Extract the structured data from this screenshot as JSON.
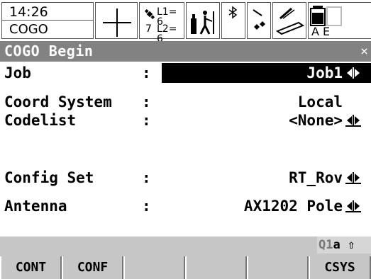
{
  "status": {
    "time": "14:26",
    "app": "COGO",
    "l1": "L1= 6",
    "l2": "L2= 6",
    "sat_count": "7",
    "battery_letters": "A E"
  },
  "title": {
    "text": "COGO Begin",
    "close": "×"
  },
  "form": {
    "job": {
      "label": "Job",
      "colon": ":",
      "value": "Job1"
    },
    "coord_system": {
      "label": "Coord System",
      "colon": ":",
      "value": "Local"
    },
    "codelist": {
      "label": "Codelist",
      "colon": ":",
      "value": "<None>"
    },
    "config_set": {
      "label": "Config Set",
      "colon": ":",
      "value": "RT_Rov"
    },
    "antenna": {
      "label": "Antenna",
      "colon": ":",
      "value": "AX1202 Pole"
    }
  },
  "mode": {
    "q1": "Q1",
    "rest": "a ⇧"
  },
  "softkeys": {
    "f1": "CONT",
    "f2": "CONF",
    "f3": "",
    "f4": "",
    "f5": "",
    "f6": "CSYS"
  },
  "icons": {
    "position": "crosshair-icon",
    "satellites": "satellite-icon",
    "rtk": "rtk-rover-icon",
    "bluetooth": "bluetooth-icon",
    "misc": "line-tool-icon",
    "pen": "pen-icon",
    "battery": "battery-icon",
    "arrows": "left-right-arrow-icon"
  }
}
